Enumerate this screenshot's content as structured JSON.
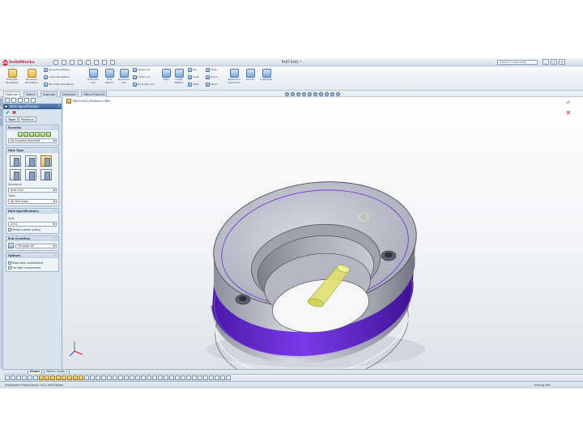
{
  "app": {
    "logo_text": "SolidWorks",
    "document_title": "PART-0341 *",
    "search_placeholder": "Search Commands",
    "window_buttons": [
      "_",
      "□",
      "×"
    ]
  },
  "ribbon": {
    "large_commands": [
      {
        "label": "Extruded\nBoss/Base"
      },
      {
        "label": "Revolved\nBoss/Base"
      },
      {
        "label": "Extruded\nCut"
      },
      {
        "label": "Hole\nWizard"
      },
      {
        "label": "Revolved\nCut"
      },
      {
        "label": "Reference\nGeometry"
      },
      {
        "label": "Curves"
      },
      {
        "label": "Instant3D"
      }
    ],
    "small_commands": [
      "Swept Boss/Base",
      "Lofted Boss/Base",
      "Boundary Boss/Base",
      "Swept Cut",
      "Lofted Cut",
      "Boundary Cut",
      "Fillet",
      "Linear Pattern",
      "Rib",
      "Draft",
      "Shell",
      "Wrap",
      "Dome",
      "Mirror"
    ]
  },
  "tabs": [
    "Features",
    "Sketch",
    "Evaluate",
    "DimXpert",
    "Office Products"
  ],
  "feature_flyout": "PART-0341 (Default<<Def...",
  "property_manager": {
    "title": "Hole Specification",
    "help": "?",
    "ok_symbol": "✔",
    "cancel_symbol": "✖",
    "subtabs": [
      "Type",
      "Positions"
    ],
    "favorite": {
      "heading": "Favorite",
      "value": "No Favorite Selected"
    },
    "hole_type": {
      "heading": "Hole Type",
      "standard_label": "Standard:",
      "standard_value": "Ansi Inch",
      "type_label": "Type:",
      "type_value": "All Drill sizes"
    },
    "hole_specifications": {
      "heading": "Hole Specifications",
      "size_label": "Size:",
      "size_value": "3/16",
      "custom_sizing": "Show custom sizing"
    },
    "end_condition": {
      "heading": "End Condition",
      "value": "Through All"
    },
    "options": {
      "heading": "Options",
      "items": [
        "Near side countersink",
        "Far side countersink"
      ]
    }
  },
  "viewport": {
    "confirm_ok": "✔",
    "confirm_cancel": "✖",
    "colors": {
      "body": "#b5b9c6",
      "groove": "#6a2bd9",
      "hole_preview": "#e0e070",
      "edge": "#3b3f4a"
    }
  },
  "bottom_tabs": [
    "Model",
    "Motion Study 1"
  ],
  "status": {
    "left": "SolidWorks Professional 2011 x64 Edition",
    "right": "Editing Part"
  }
}
